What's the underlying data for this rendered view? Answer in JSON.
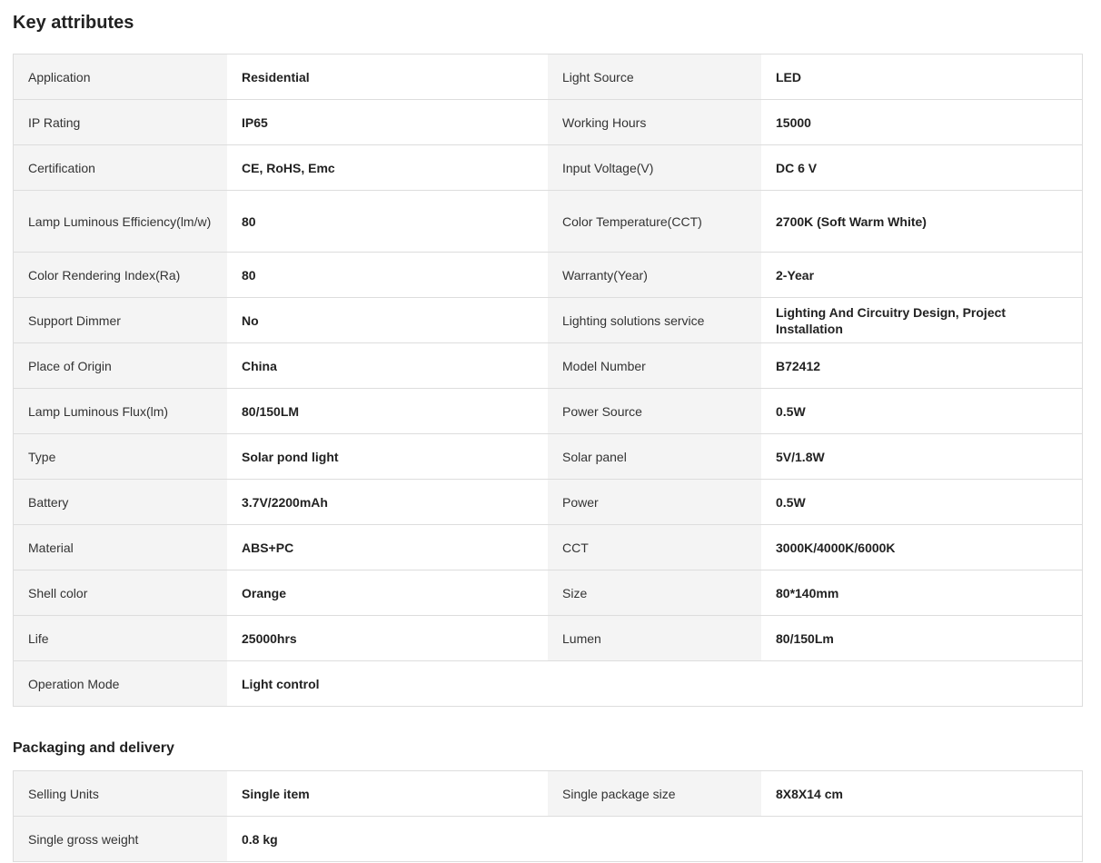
{
  "key_attributes": {
    "title": "Key attributes",
    "rows": [
      [
        {
          "k": "Application",
          "v": "Residential"
        },
        {
          "k": "Light Source",
          "v": "LED"
        }
      ],
      [
        {
          "k": "IP Rating",
          "v": "IP65"
        },
        {
          "k": "Working Hours",
          "v": "15000"
        }
      ],
      [
        {
          "k": "Certification",
          "v": "CE, RoHS, Emc"
        },
        {
          "k": "Input Voltage(V)",
          "v": "DC 6 V"
        }
      ],
      [
        {
          "k": "Lamp Luminous Efficiency(lm/w)",
          "v": "80"
        },
        {
          "k": "Color Temperature(CCT)",
          "v": "2700K (Soft Warm White)"
        }
      ],
      [
        {
          "k": "Color Rendering Index(Ra)",
          "v": "80"
        },
        {
          "k": "Warranty(Year)",
          "v": "2-Year"
        }
      ],
      [
        {
          "k": "Support Dimmer",
          "v": "No"
        },
        {
          "k": "Lighting solutions service",
          "v": "Lighting And Circuitry Design, Project Installation"
        }
      ],
      [
        {
          "k": "Place of Origin",
          "v": "China"
        },
        {
          "k": "Model Number",
          "v": "B72412"
        }
      ],
      [
        {
          "k": "Lamp Luminous Flux(lm)",
          "v": "80/150LM"
        },
        {
          "k": "Power Source",
          "v": "0.5W"
        }
      ],
      [
        {
          "k": "Type",
          "v": "Solar pond light"
        },
        {
          "k": "Solar panel",
          "v": "5V/1.8W"
        }
      ],
      [
        {
          "k": "Battery",
          "v": "3.7V/2200mAh"
        },
        {
          "k": "Power",
          "v": "0.5W"
        }
      ],
      [
        {
          "k": "Material",
          "v": "ABS+PC"
        },
        {
          "k": "CCT",
          "v": "3000K/4000K/6000K"
        }
      ],
      [
        {
          "k": "Shell color",
          "v": "Orange"
        },
        {
          "k": "Size",
          "v": "80*140mm"
        }
      ],
      [
        {
          "k": "Life",
          "v": "25000hrs"
        },
        {
          "k": "Lumen",
          "v": "80/150Lm"
        }
      ],
      [
        {
          "k": "Operation Mode",
          "v": "Light control"
        }
      ]
    ]
  },
  "packaging": {
    "title": "Packaging and delivery",
    "rows": [
      [
        {
          "k": "Selling Units",
          "v": "Single item"
        },
        {
          "k": "Single package size",
          "v": "8X8X14 cm"
        }
      ],
      [
        {
          "k": "Single gross weight",
          "v": "0.8 kg"
        }
      ]
    ]
  }
}
